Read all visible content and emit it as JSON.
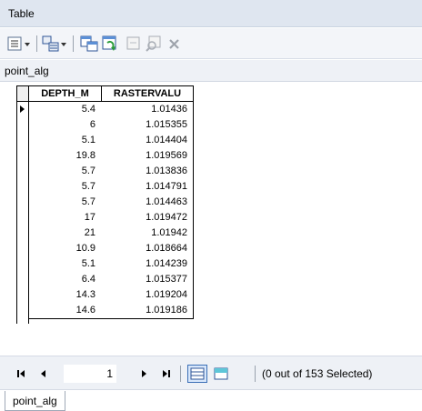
{
  "window": {
    "title": "Table"
  },
  "toolbar": {
    "icons": [
      "table-options-icon",
      "related-tables-icon",
      "select-by-attributes-icon",
      "switch-selection-icon",
      "clear-selection-icon",
      "zoom-to-selected-icon",
      "delete-selected-icon"
    ]
  },
  "table": {
    "name": "point_alg",
    "columns": [
      "DEPTH_M",
      "RASTERVALU"
    ],
    "rows": [
      [
        "5.4",
        "1.01436"
      ],
      [
        "6",
        "1.015355"
      ],
      [
        "5.1",
        "1.014404"
      ],
      [
        "19.8",
        "1.019569"
      ],
      [
        "5.7",
        "1.013836"
      ],
      [
        "5.7",
        "1.014791"
      ],
      [
        "5.7",
        "1.014463"
      ],
      [
        "17",
        "1.019472"
      ],
      [
        "21",
        "1.01942"
      ],
      [
        "10.9",
        "1.018664"
      ],
      [
        "5.1",
        "1.014239"
      ],
      [
        "6.4",
        "1.015377"
      ],
      [
        "14.3",
        "1.019204"
      ],
      [
        "14.6",
        "1.019186"
      ]
    ]
  },
  "navigation": {
    "current_record": "1",
    "selection_text": "(0 out of 153 Selected)"
  },
  "tabs": [
    "point_alg"
  ]
}
